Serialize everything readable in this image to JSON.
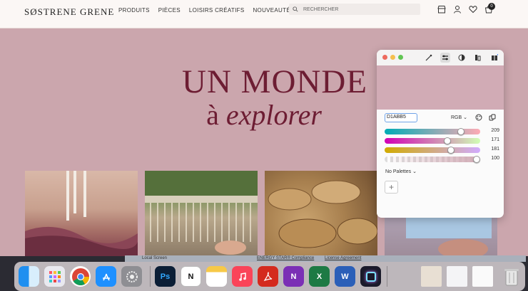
{
  "site": {
    "logo": "SØSTRENE GRENE",
    "nav": [
      "PRODUITS",
      "PIÈCES",
      "LOISIRS CRÉATIFS",
      "NOUVEAUTÉS"
    ],
    "search_placeholder": "RECHERCHER",
    "cart_count": "0",
    "hero_line1": "UN MONDE",
    "hero_line2_a": "à",
    "hero_line2_b": "explorer"
  },
  "picker": {
    "hex": "D1ABB5",
    "mode": "RGB",
    "swatch_color": "#d1abb5",
    "channels": [
      {
        "name": "red",
        "value": "209",
        "fraction": 0.82
      },
      {
        "name": "green",
        "value": "171",
        "fraction": 0.67
      },
      {
        "name": "blue",
        "value": "181",
        "fraction": 0.71
      },
      {
        "name": "alpha",
        "value": "100",
        "fraction": 1.0
      }
    ],
    "palettes_label": "No Palettes",
    "add_label": "+"
  },
  "strip": {
    "left": "Local Screen",
    "mid": "ENERGY STAR® Compliance",
    "right": "License Agreement"
  },
  "dock": {
    "apps": [
      "finder-icon",
      "launchpad-icon",
      "chrome-icon",
      "app-store-icon",
      "system-settings-icon",
      "photoshop-icon",
      "notion-icon",
      "notes-icon",
      "music-icon",
      "acrobat-icon",
      "onenote-icon",
      "excel-icon",
      "word-icon",
      "screen-recorder-icon",
      "document-stack-icon",
      "window-preview-icon",
      "window-preview-2-icon",
      "trash-icon"
    ],
    "labels": {
      "photoshop": "Ps",
      "notion": "N",
      "excel": "X",
      "word": "W",
      "onenote": "N"
    }
  }
}
